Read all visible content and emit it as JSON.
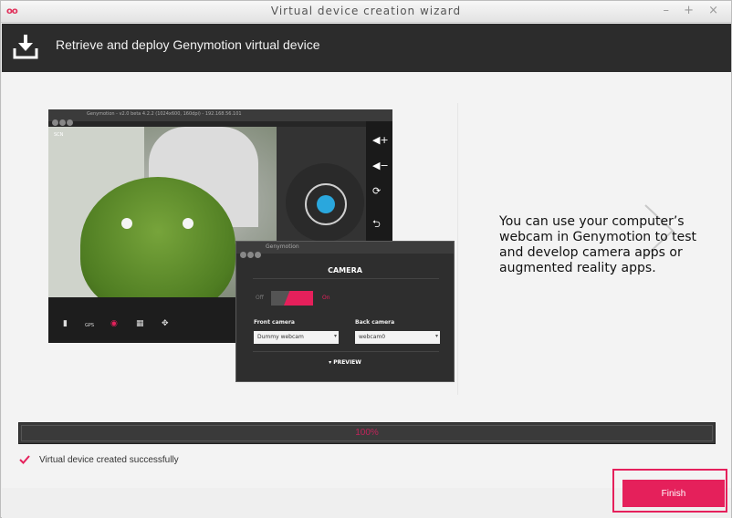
{
  "window": {
    "logo": "oo",
    "title": "Virtual device creation wizard",
    "controls": "– + ×"
  },
  "header": {
    "title": "Retrieve and deploy Genymotion virtual device",
    "icon": "download-icon"
  },
  "screenshot": {
    "window_title": "Genymotion - v2.0 beta 4.2.2 (1024x600, 160dpi) - 192.168.56.101",
    "scene_label": "SCN",
    "toolbar_icons": [
      "battery-icon",
      "gps-icon",
      "webcam-icon",
      "clapperboard-icon",
      "move-icon"
    ],
    "gps_label": "GPS",
    "side_icons": [
      "volume-up-icon",
      "volume-down-icon",
      "rotate-icon",
      "back-icon"
    ],
    "camera_dialog": {
      "window_title": "Genymotion",
      "title": "CAMERA",
      "toggle_off": "Off",
      "toggle_on": "On",
      "front_label": "Front camera",
      "front_value": "Dummy webcam",
      "back_label": "Back camera",
      "back_value": "webcam0",
      "preview": "PREVIEW"
    }
  },
  "description": "You can use your computer’s webcam in Genymotion to test and develop camera apps or augmented reality apps.",
  "progress": {
    "value": 100,
    "label": "100%"
  },
  "status": {
    "text": "Virtual device created successfully"
  },
  "footer": {
    "finish_label": "Finish"
  },
  "colors": {
    "accent": "#e5205b",
    "header_bg": "#2c2c2c",
    "progress_bg": "#3a3a3a"
  }
}
